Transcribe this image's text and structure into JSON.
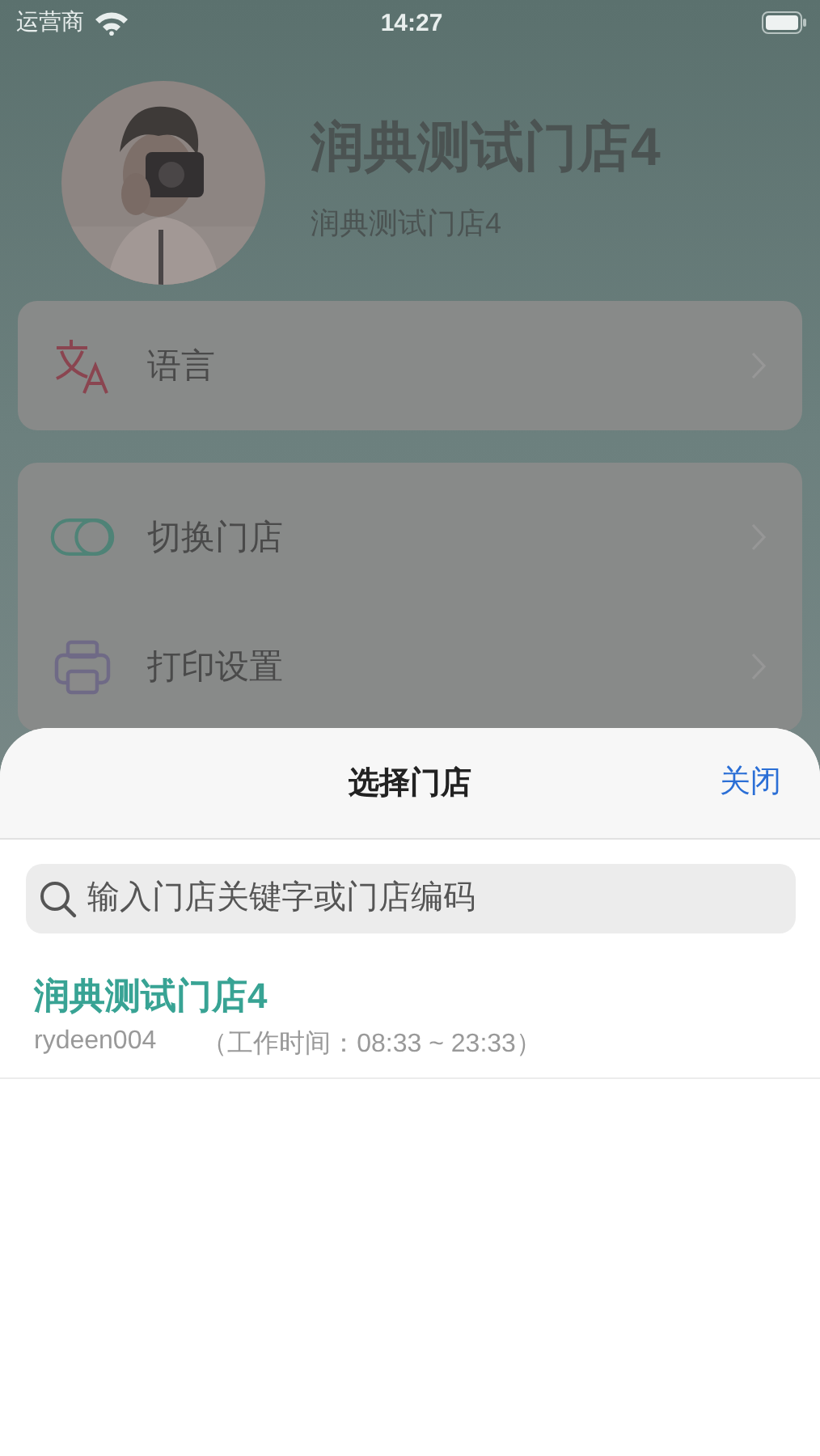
{
  "status_bar": {
    "carrier": "运营商",
    "time": "14:27"
  },
  "profile": {
    "title": "润典测试门店4",
    "subtitle": "润典测试门店4"
  },
  "menu_groups": [
    {
      "items": [
        {
          "label": "语言"
        }
      ]
    },
    {
      "items": [
        {
          "label": "切换门店"
        },
        {
          "label": "打印设置"
        }
      ]
    }
  ],
  "sheet": {
    "title": "选择门店",
    "close": "关闭",
    "search": {
      "placeholder": "输入门店关键字或门店编码"
    },
    "stores": [
      {
        "name": "润典测试门店4",
        "code": "rydeen004",
        "hours": "（工作时间：08:33 ~ 23:33）"
      }
    ]
  }
}
